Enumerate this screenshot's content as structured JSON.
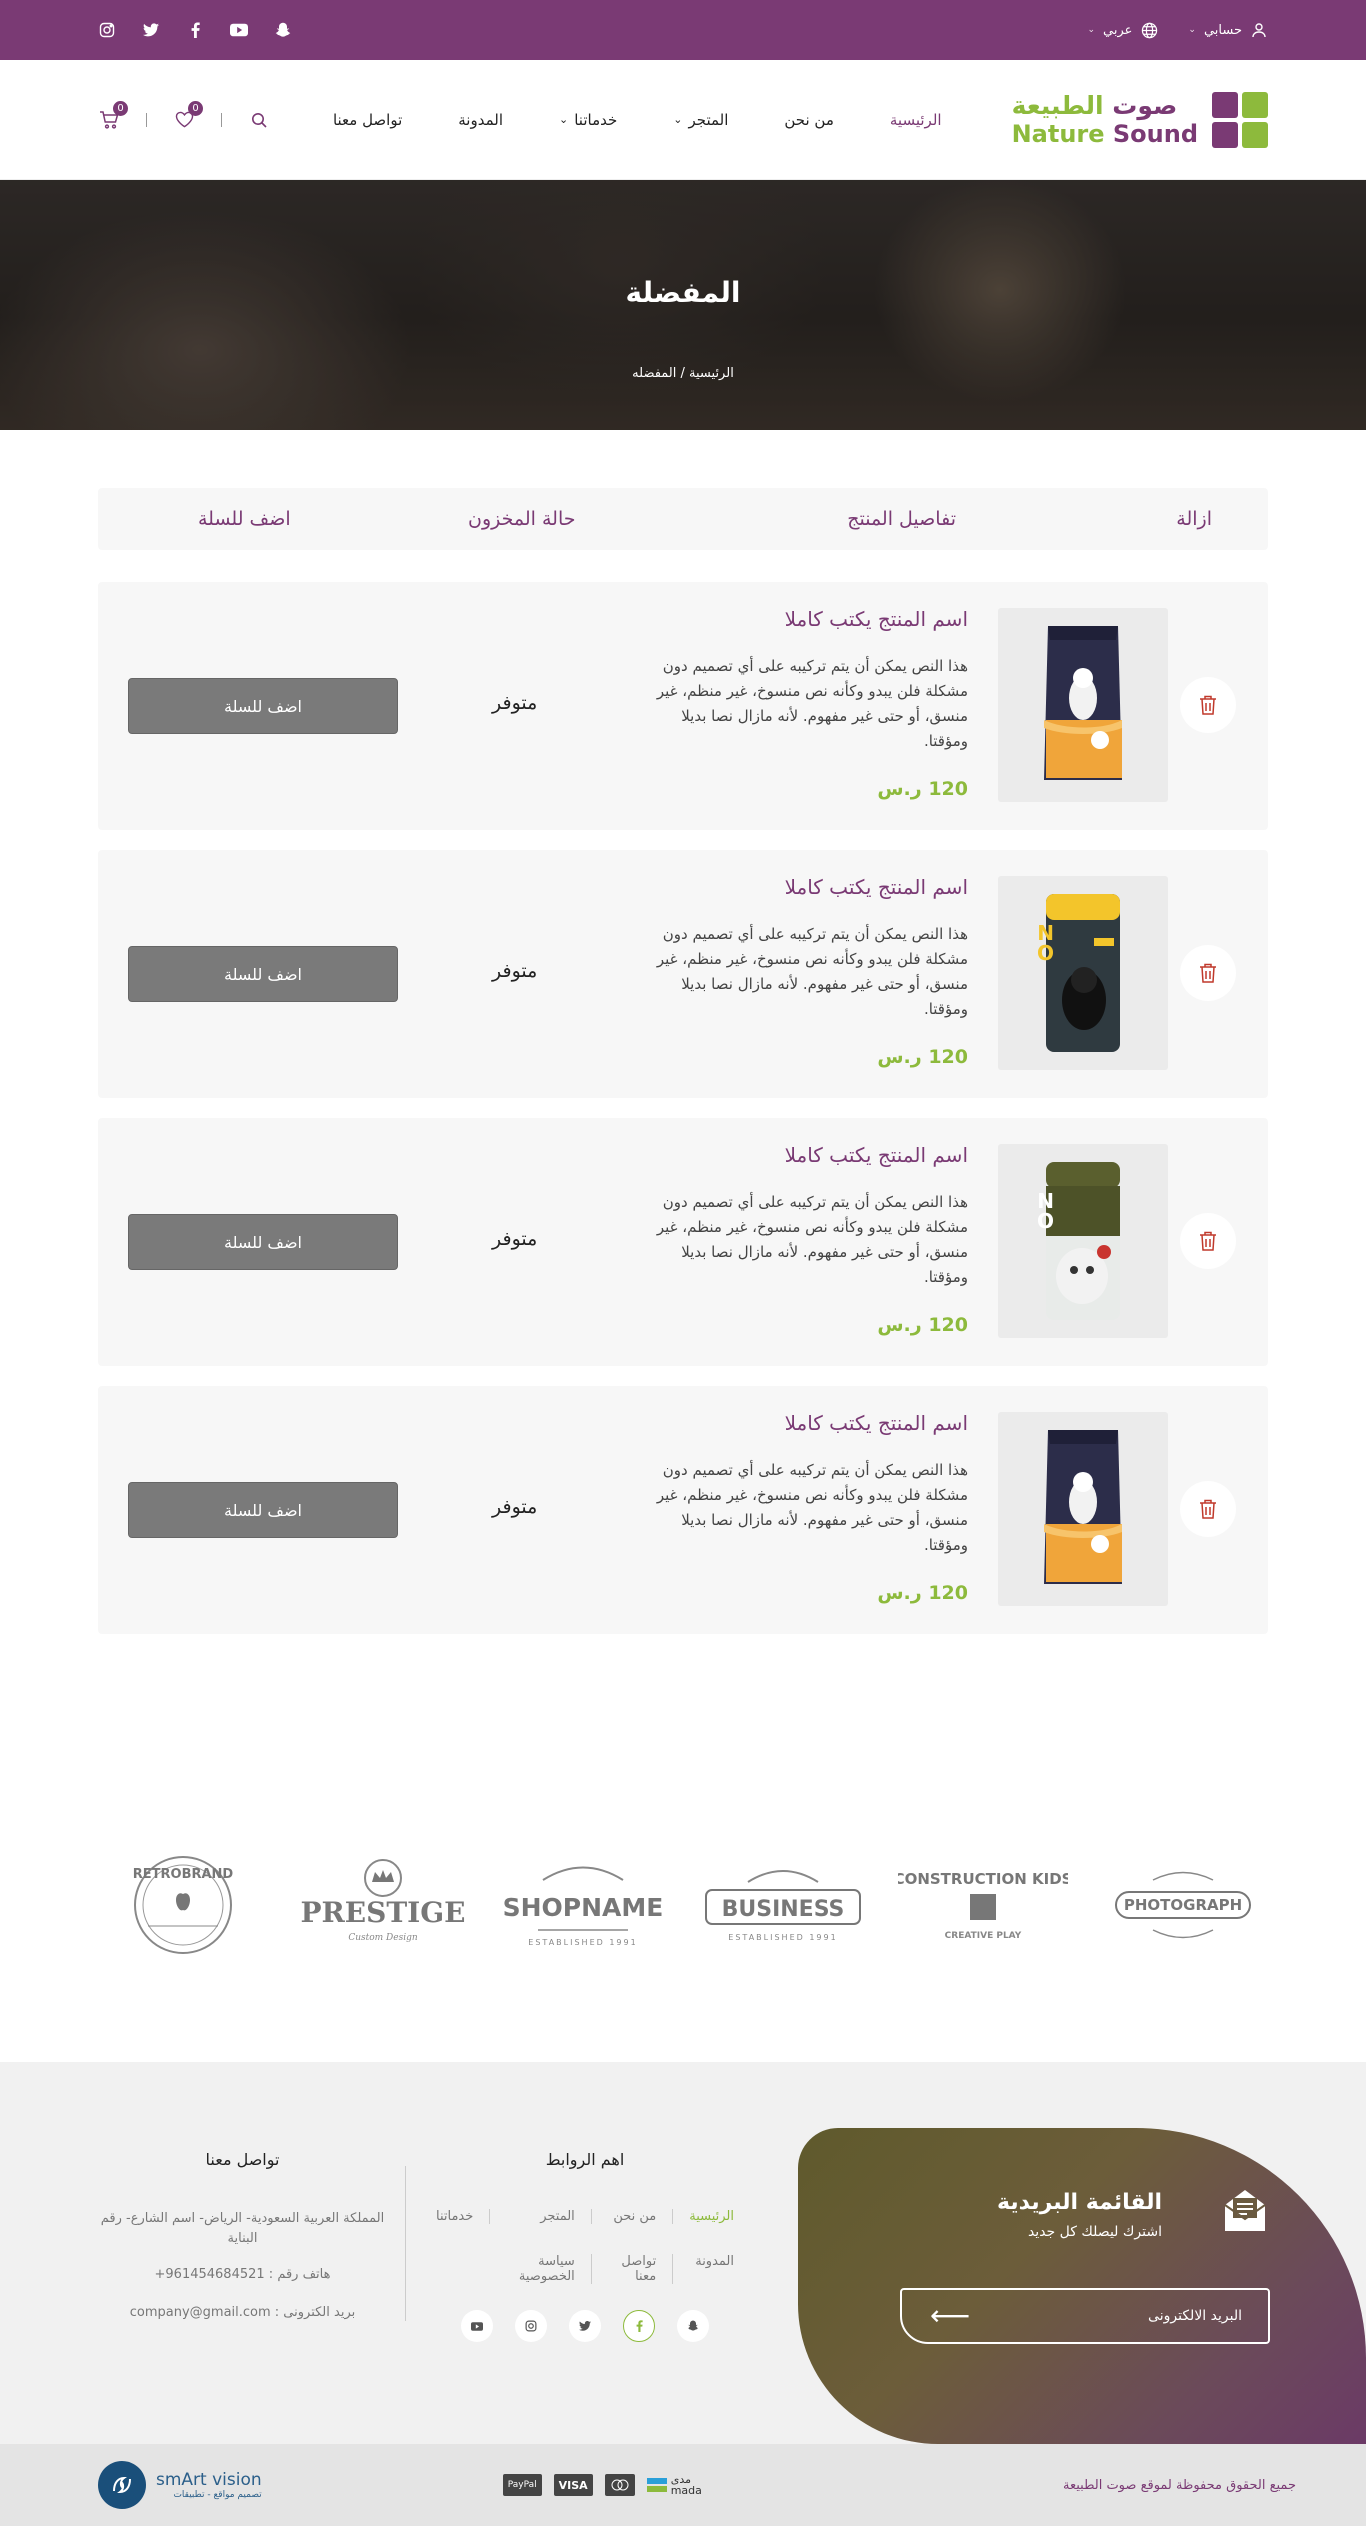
{
  "topbar": {
    "account_label": "حسابي",
    "language_label": "عربي",
    "socials": [
      "snapchat-icon",
      "youtube-icon",
      "facebook-icon",
      "twitter-icon",
      "instagram-icon"
    ]
  },
  "logo": {
    "ar_part1": "صوت",
    "ar_part2": "الطبيعة",
    "en_part1": "Nature",
    "en_part2": "Sound"
  },
  "nav": {
    "items": [
      {
        "label": "الرئيسية",
        "active": true,
        "dropdown": false
      },
      {
        "label": "من نحن",
        "dropdown": false
      },
      {
        "label": "المتجر",
        "dropdown": true
      },
      {
        "label": "خدماتنا",
        "dropdown": true
      },
      {
        "label": "المدونة",
        "dropdown": false
      },
      {
        "label": "تواصل معنا",
        "dropdown": false
      }
    ]
  },
  "header_icons": {
    "wishlist_count": "0",
    "cart_count": "0"
  },
  "hero": {
    "title": "المفضلة",
    "breadcrumb": "الرئيسية / المفضله"
  },
  "table": {
    "headers": {
      "remove": "ازالة",
      "details": "تفاصيل المنتج",
      "stock": "حالة المخزون",
      "add": "اضف للسلة"
    }
  },
  "products": [
    {
      "name": "اسم المنتج يكتب كاملا",
      "desc": "هذا النص يمكن أن يتم تركيبه على أي تصميم دون مشكلة فلن يبدو وكأنه نص منسوخ، غير منظم، غير منسق، أو حتى غير مفهوم. لأنه مازال نصا بديلا ومؤقتا.",
      "price": "120 ر.س",
      "stock": "متوفر",
      "button": "اضف للسلة",
      "image": "dark-dog-food-bag"
    },
    {
      "name": "اسم المنتج يكتب كاملا",
      "desc": "هذا النص يمكن أن يتم تركيبه على أي تصميم دون مشكلة فلن يبدو وكأنه نص منسوخ، غير منظم، غير منسق، أو حتى غير مفهوم. لأنه مازال نصا بديلا ومؤقتا.",
      "price": "120 ر.س",
      "stock": "متوفر",
      "button": "اضف للسلة",
      "image": "bingo-dog-food-pouch-yellow"
    },
    {
      "name": "اسم المنتج يكتب كاملا",
      "desc": "هذا النص يمكن أن يتم تركيبه على أي تصميم دون مشكلة فلن يبدو وكأنه نص منسوخ، غير منظم، غير منسق، أو حتى غير مفهوم. لأنه مازال نصا بديلا ومؤقتا.",
      "price": "120 ر.س",
      "stock": "متوفر",
      "button": "اضف للسلة",
      "image": "bingo-dog-food-pouch-olive"
    },
    {
      "name": "اسم المنتج يكتب كاملا",
      "desc": "هذا النص يمكن أن يتم تركيبه على أي تصميم دون مشكلة فلن يبدو وكأنه نص منسوخ، غير منظم، غير منسق، أو حتى غير مفهوم. لأنه مازال نصا بديلا ومؤقتا.",
      "price": "120 ر.س",
      "stock": "متوفر",
      "button": "اضف للسلة",
      "image": "dark-dog-food-bag"
    }
  ],
  "brands": [
    "RETROBRAND",
    "PRESTIGE",
    "SHOPNAME",
    "BUSINESS",
    "CONSTRUCTION KIDS",
    "PHOTOGRAPH"
  ],
  "newsletter": {
    "title": "القائمة البريدية",
    "subtitle": "اشترك ليصلك كل جديد",
    "placeholder": "البريد الالكترونى"
  },
  "footer_links": {
    "title": "اهم الروابط",
    "items": [
      {
        "label": "الرئيسية",
        "active": true
      },
      {
        "label": "من نحن"
      },
      {
        "label": "المتجر"
      },
      {
        "label": "خدماتنا"
      },
      {
        "label": "المدونة"
      },
      {
        "label": "تواصل معنا"
      },
      {
        "label": "سياسة الخصوصية"
      }
    ]
  },
  "contact": {
    "title": "تواصل معنا",
    "address": "المملكة العربية السعودية- الرياض- اسم الشارع- رقم البناية",
    "phone": "هاتف رقم : 961454684521+",
    "email": "بريد الكترونى : company@gmail.com"
  },
  "bottom": {
    "copyright": "جميع الحقوق محفوظة لموقع صوت الطبيعة",
    "payments": [
      "mada",
      "MasterCard",
      "VISA",
      "PayPal"
    ],
    "mada_ar": "مدى",
    "credit_name": "smArt vision",
    "credit_sub": "تصميم مواقع - تطبيقات"
  },
  "colors": {
    "brand_purple": "#7a3a74",
    "brand_green": "#8dba3c",
    "button_gray": "#7a7a7a"
  }
}
